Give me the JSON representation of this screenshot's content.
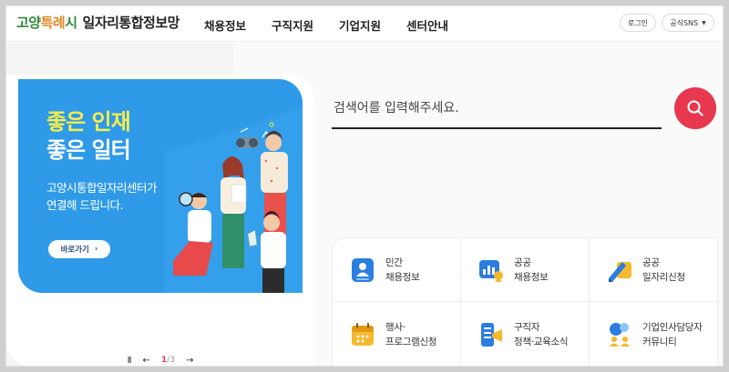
{
  "header": {
    "logo": {
      "part1": "고양",
      "part2": "특례",
      "part3": "시",
      "part4": "일자리통합정보망"
    },
    "nav": [
      "채용정보",
      "구직지원",
      "기업지원",
      "센터안내"
    ],
    "login_label": "로그인",
    "sns_label": "공식SNS",
    "sns_caret": "▼"
  },
  "banner": {
    "title_line1": "좋은 인재",
    "title_line2": "좋은 일터",
    "sub_line1": "고양시통합일자리센터가",
    "sub_line2": "연결해 드립니다.",
    "button_label": "바로가기",
    "button_arrow": "›"
  },
  "slider": {
    "pause": "Ⅱ",
    "prev": "←",
    "current": "1",
    "sep": "/",
    "total": "3",
    "next": "→"
  },
  "search": {
    "placeholder": "검색어를 입력해주세요."
  },
  "quick_menu": [
    {
      "line1": "민간",
      "line2": "채용정보",
      "icon": "person-card-icon"
    },
    {
      "line1": "공공",
      "line2": "채용정보",
      "icon": "public-chart-icon"
    },
    {
      "line1": "공공",
      "line2": "일자리신청",
      "icon": "pen-form-icon"
    },
    {
      "line1": "행사·",
      "line2": "프로그램신청",
      "icon": "calendar-icon"
    },
    {
      "line1": "구직자",
      "line2": "정책·교육소식",
      "icon": "megaphone-icon"
    },
    {
      "line1": "기업인사담당자",
      "line2": "커뮤니티",
      "icon": "chat-people-icon"
    }
  ],
  "colors": {
    "brand_green": "#2f8a3a",
    "brand_orange": "#e2892b",
    "banner_blue": "#2e9ae8",
    "banner_yellow": "#f6ec4d",
    "search_red": "#e8384f"
  }
}
